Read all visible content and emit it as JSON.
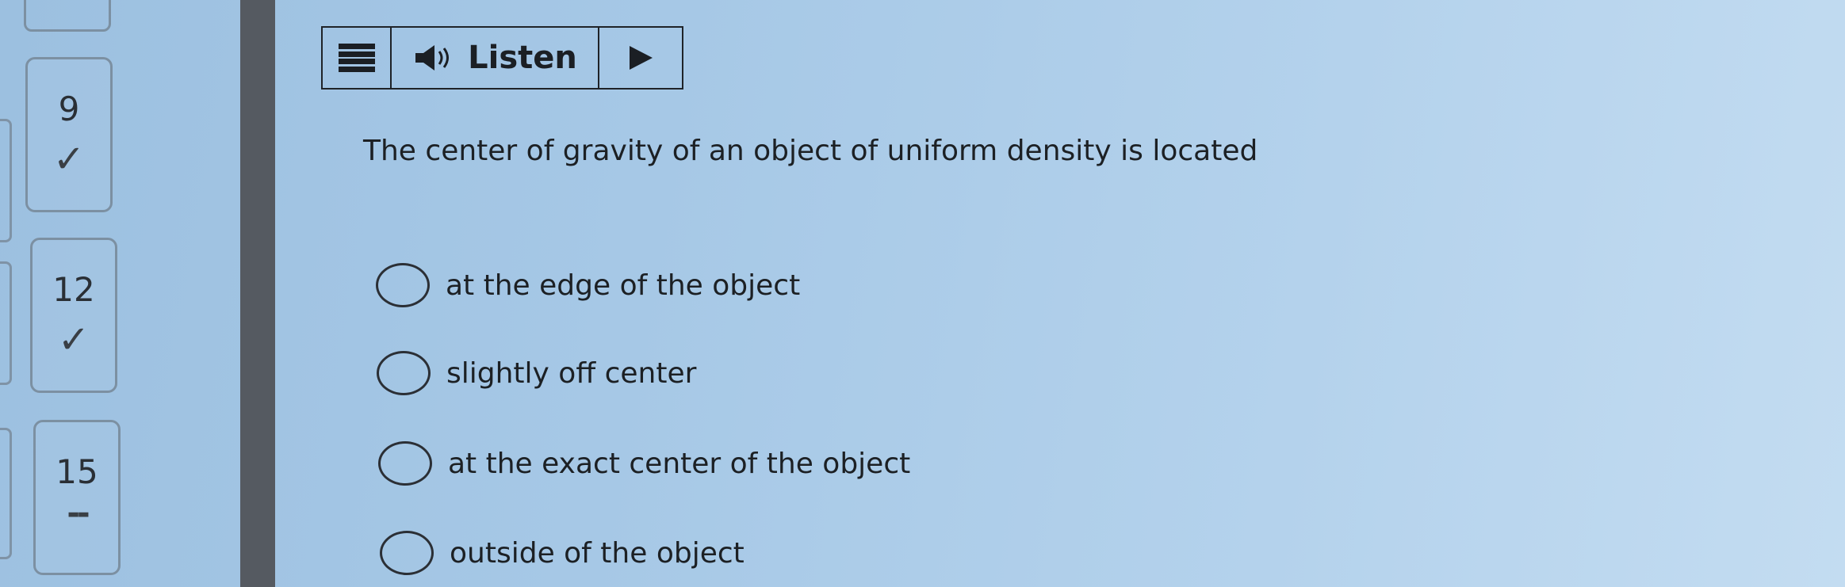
{
  "navigator": {
    "items": [
      {
        "number": "9",
        "status": "✓"
      },
      {
        "number": "12",
        "status": "✓"
      },
      {
        "number": "15",
        "status": "--"
      }
    ]
  },
  "toolbar": {
    "listen_label": "Listen",
    "icons": [
      "menu-icon",
      "speaker-icon",
      "play-icon"
    ]
  },
  "question": {
    "text": "The center of gravity of an object of uniform density is located",
    "choices": [
      {
        "label": "at the edge of the object"
      },
      {
        "label": "slightly off center"
      },
      {
        "label": "at the exact center of the object"
      },
      {
        "label": "outside of the object"
      }
    ]
  }
}
